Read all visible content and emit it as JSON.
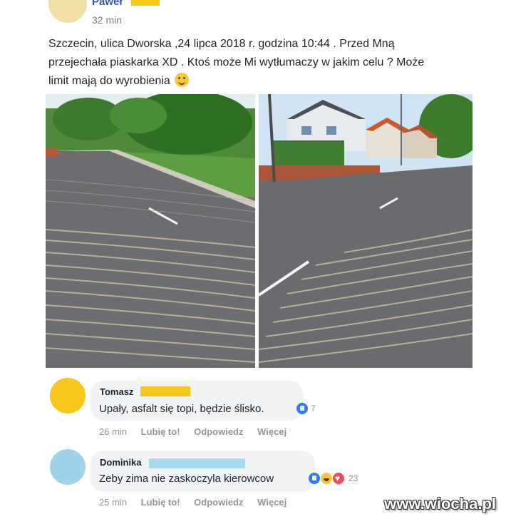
{
  "post": {
    "author": "Paweł",
    "time": "32 min",
    "text_line1": "Szczecin, ulica Dworska ,24 lipca 2018 r. godzina 10:44 . Przed Mną",
    "text_line2": "przejechała piaskarka XD . Ktoś może Mi wytłumaczy w jakim celu ? Może",
    "text_line3": "limit mają do wyrobienia",
    "emoji": "smile-emoji"
  },
  "comments": [
    {
      "author": "Tomasz",
      "text": "Upały, asfalt się topi, będzie ślisko.",
      "reactions_count": "7",
      "time": "26 min",
      "like": "Lubię to!",
      "reply": "Odpowiedz",
      "more": "Więcej",
      "avatar_color": "#f7c71c",
      "name_bar_color": "#f5c71a"
    },
    {
      "author": "Dominika",
      "text": "Zeby zima nie zaskoczyla kierowcow",
      "reactions_count": "23",
      "time": "25 min",
      "like": "Lubię to!",
      "reply": "Odpowiedz",
      "more": "Więcej",
      "avatar_color": "#9fd4ea",
      "name_bar_color": "#a6d8ef"
    }
  ],
  "watermark": "www.wiocha.pl",
  "colors": {
    "author_link": "#385898",
    "like_blue": "#2f7bf6",
    "bubble": "#f2f3f5"
  }
}
